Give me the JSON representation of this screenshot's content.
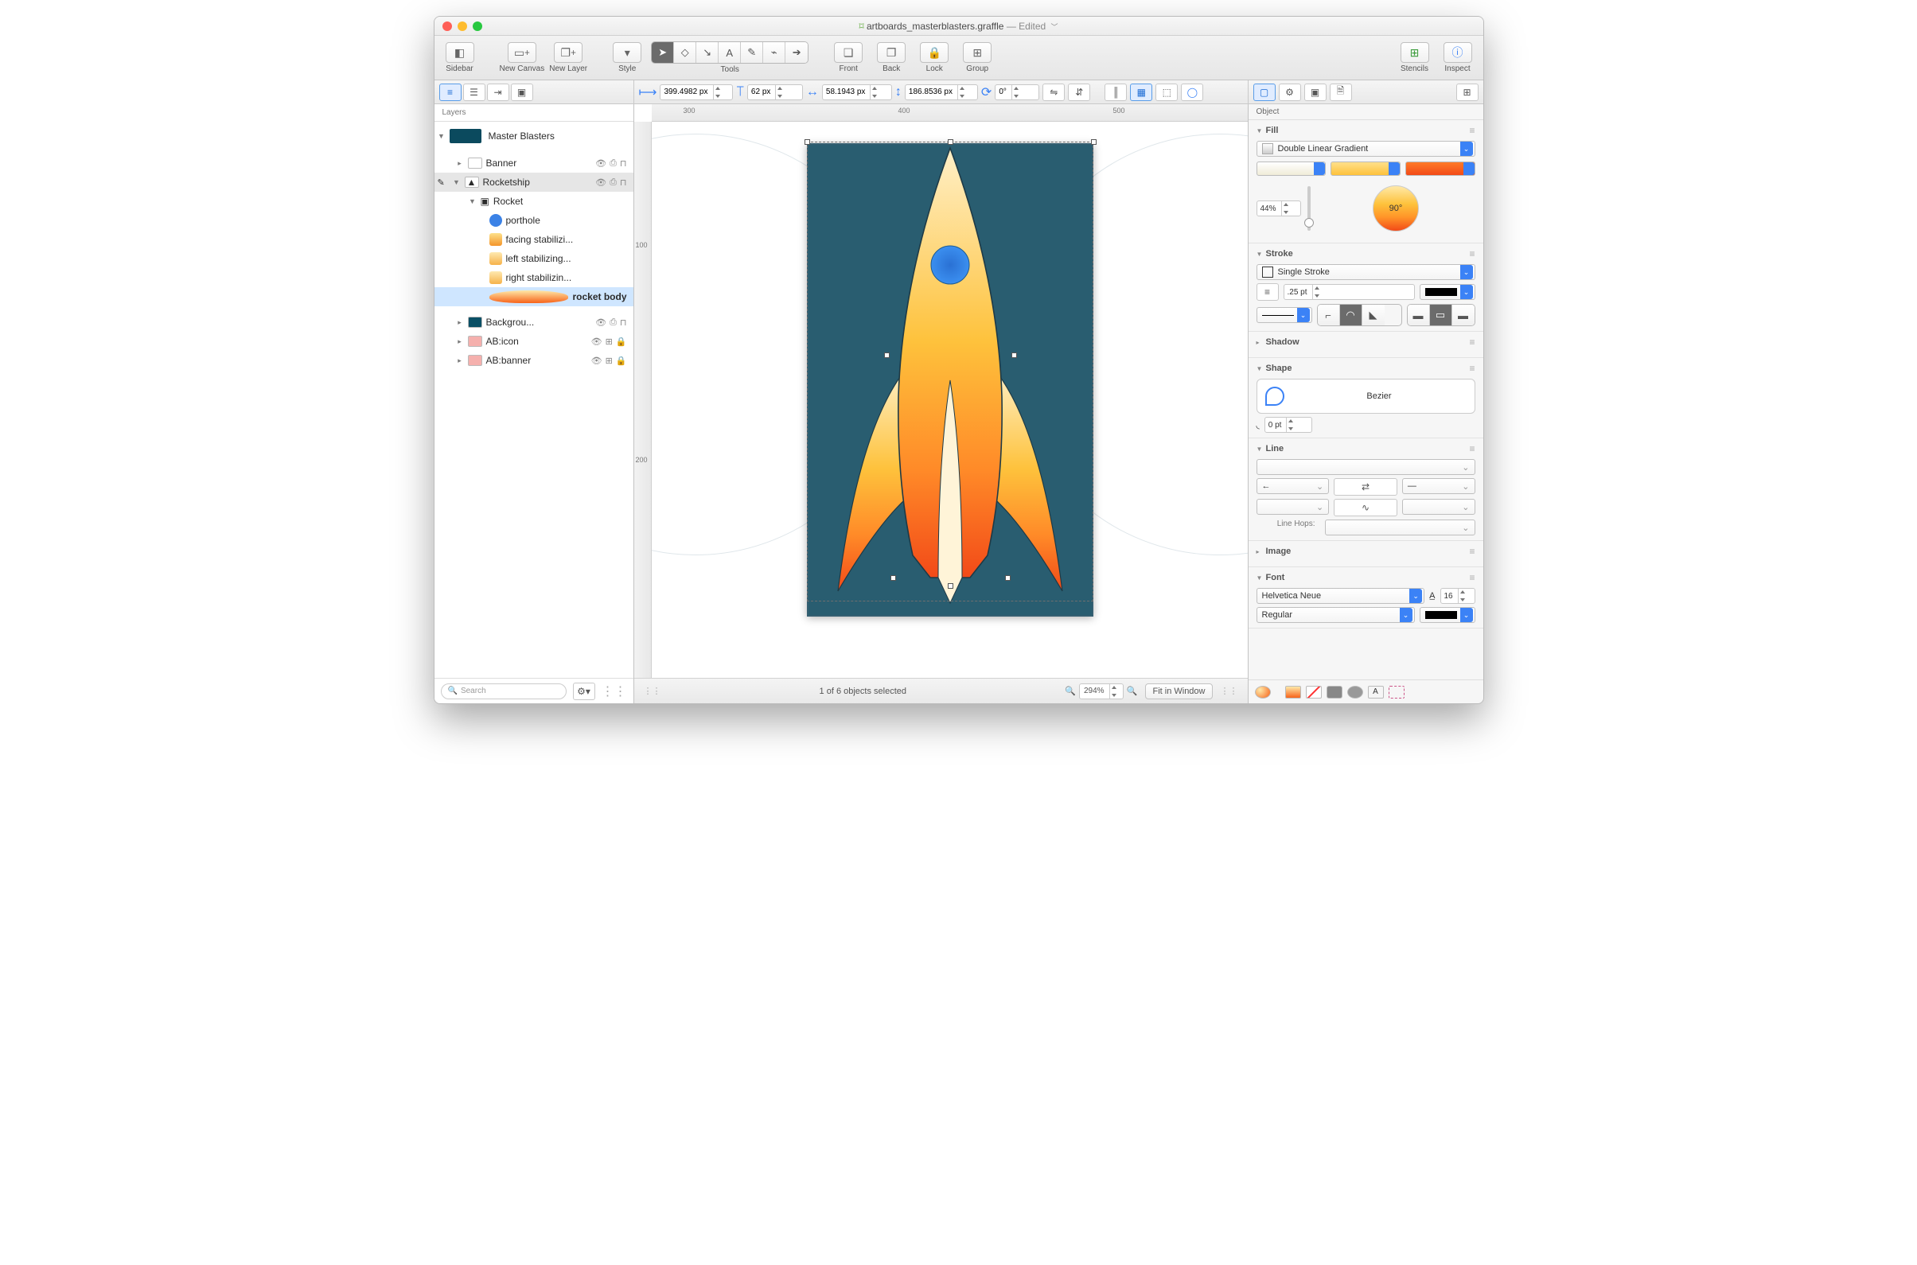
{
  "window": {
    "filename": "artboards_masterblasters.graffle",
    "status": "— Edited"
  },
  "toolbar": {
    "sidebar": "Sidebar",
    "newCanvas": "New Canvas",
    "newLayer": "New Layer",
    "style": "Style",
    "tools": "Tools",
    "front": "Front",
    "back": "Back",
    "lock": "Lock",
    "group": "Group",
    "stencils": "Stencils",
    "inspect": "Inspect"
  },
  "geometry": {
    "x": "399.4982 px",
    "y": "62 px",
    "w": "58.1943 px",
    "h": "186.8536 px",
    "r": "0°"
  },
  "ruler": {
    "h": [
      "300",
      "400",
      "500"
    ],
    "v": [
      "100",
      "200"
    ]
  },
  "sidebar": {
    "panel": "Layers",
    "canvas": "Master Blasters",
    "layers": {
      "banner": "Banner",
      "rocketship": "Rocketship",
      "rocketGroup": "Rocket",
      "porthole": "porthole",
      "facing": "facing stabilizi...",
      "left": "left stabilizing...",
      "right": "right stabilizin...",
      "body": "rocket body",
      "background": "Backgrou...",
      "abicon": "AB:icon",
      "abbanner": "AB:banner"
    },
    "searchPlaceholder": "Search"
  },
  "canvasFoot": {
    "selection": "1 of 6 objects selected",
    "zoom": "294%",
    "fit": "Fit in Window"
  },
  "inspector": {
    "panel": "Object",
    "fill": {
      "title": "Fill",
      "type": "Double Linear Gradient",
      "percent": "44%",
      "angle": "90°",
      "stops": [
        "#fff7e0",
        "#fec23c",
        "#f24a18"
      ]
    },
    "stroke": {
      "title": "Stroke",
      "type": "Single Stroke",
      "width": ".25 pt"
    },
    "shadow": {
      "title": "Shadow"
    },
    "shape": {
      "title": "Shape",
      "type": "Bezier",
      "radius": "0 pt"
    },
    "line": {
      "title": "Line",
      "hops": "Line Hops:"
    },
    "image": {
      "title": "Image"
    },
    "font": {
      "title": "Font",
      "family": "Helvetica Neue",
      "size": "16",
      "weight": "Regular"
    }
  }
}
